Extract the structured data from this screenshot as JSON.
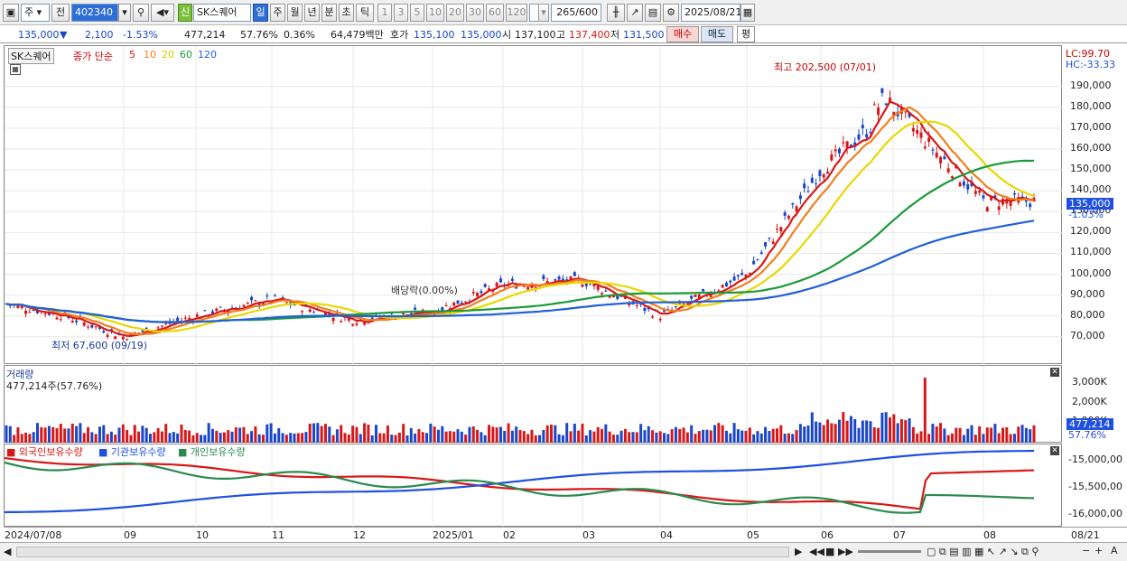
{
  "toolbar": {
    "type_select": "주",
    "all_label": "전",
    "stock_code": "402340",
    "new_badge": "신",
    "stock_name": "SK스퀘어",
    "periods": [
      "일",
      "주",
      "월",
      "년",
      "분",
      "초",
      "틱"
    ],
    "active_period": "일",
    "numbers": [
      "1",
      "3",
      "5",
      "10",
      "20",
      "30",
      "60",
      "120"
    ],
    "count": "265",
    "count_total": "/600",
    "date": "2025/08/21"
  },
  "quote": {
    "price": "135,000",
    "change": "2,100",
    "change_pct": "-1.53%",
    "volume": "477,214",
    "vol_pct": "57.76%",
    "turnover_pct": "0.36%",
    "amount": "64,479백만",
    "bid_label": "호가",
    "bid": "135,100",
    "ask": "135,000",
    "open_label": "시",
    "open": "137,100",
    "high_label": "고",
    "high": "137,400",
    "low_label": "저",
    "low": "131,500",
    "buy_label": "매수",
    "sell_label": "매도",
    "avg_label": "평"
  },
  "price_pane": {
    "name_tag": "SK스퀘어",
    "ma_title": "종가 단순",
    "ma_periods": [
      "5",
      "10",
      "20",
      "60",
      "120"
    ],
    "ma_colors": [
      "#d81818",
      "#f08020",
      "#e8d800",
      "#1a9a3a",
      "#2060d8"
    ],
    "lc": "LC:99.70",
    "hc": "HC:-33.33",
    "current_price": "135,000",
    "current_pct": "-1.03%",
    "high_annotation": "최고 202,500 (07/01)",
    "low_annotation": "최저 67,600 (09/19)",
    "dividend_annotation": "배당락(0.00%)",
    "y_ticks": [
      "190,000",
      "180,000",
      "170,000",
      "160,000",
      "150,000",
      "140,000",
      "130,000",
      "120,000",
      "110,000",
      "100,000",
      "90,000",
      "80,000",
      "70,000"
    ]
  },
  "volume_pane": {
    "title": "거래량",
    "value": "477,214주(57.76%)",
    "y_ticks": [
      "3,000K",
      "2,000K",
      "1,000K"
    ],
    "current": "477,214",
    "current_pct": "57.76%"
  },
  "holding_pane": {
    "legend": [
      "외국인보유수량",
      "기관보유수량",
      "개인보유수량"
    ],
    "colors": [
      "#d81818",
      "#2050e0",
      "#2a8a50"
    ],
    "y_ticks": [
      "-15,000,00",
      "-15,500,00",
      "-16,000,00"
    ]
  },
  "x_axis": {
    "labels": [
      "2024/07/08",
      "09",
      "10",
      "11",
      "12",
      "2025/01",
      "02",
      "03",
      "04",
      "05",
      "06",
      "07",
      "08"
    ],
    "end_label": "08/21"
  },
  "chart_data": {
    "type": "candlestick",
    "title": "SK스퀘어",
    "x": [
      "2024/07",
      "2024/08",
      "2024/09",
      "2024/10",
      "2024/11",
      "2024/12",
      "2025/01",
      "2025/02",
      "2025/03",
      "2025/04",
      "2025/05",
      "2025/06",
      "2025/07",
      "2025/08"
    ],
    "series": [
      {
        "name": "종가",
        "values": [
          86000,
          80000,
          70000,
          80000,
          88000,
          78000,
          82000,
          95000,
          97000,
          80000,
          100000,
          150000,
          180000,
          135000
        ]
      }
    ],
    "ylim": [
      60000,
      205000
    ],
    "high": 202500,
    "low": 67600
  }
}
